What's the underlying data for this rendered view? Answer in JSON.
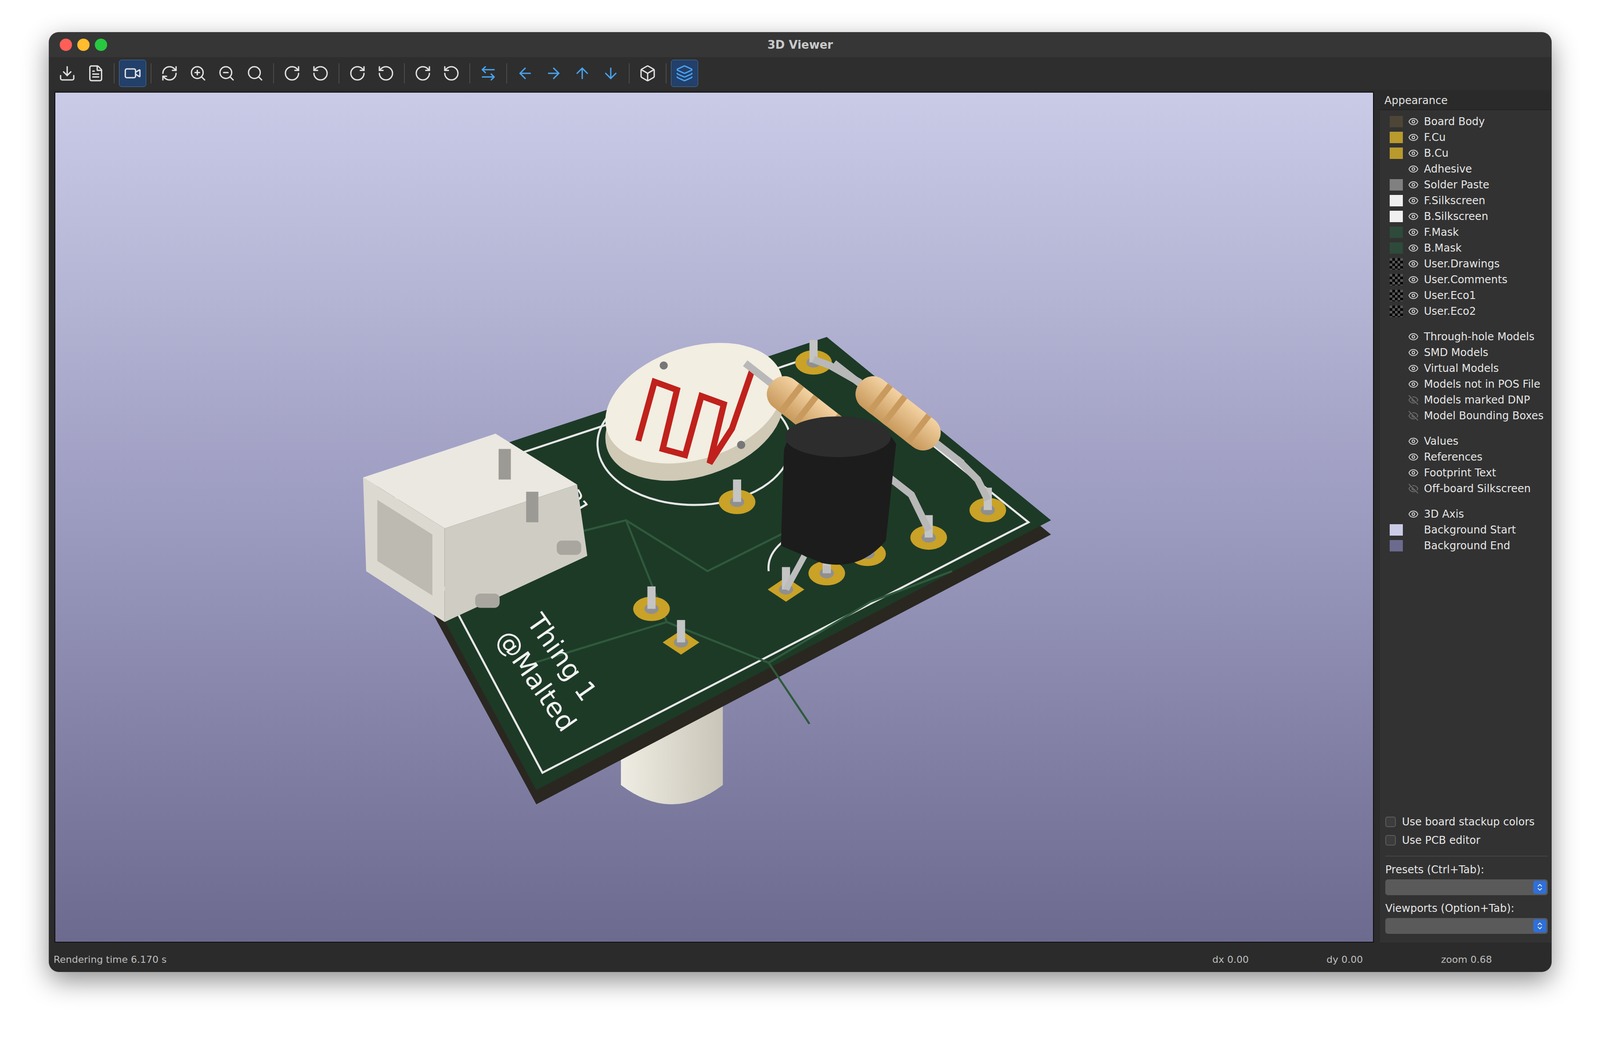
{
  "window": {
    "title": "3D Viewer"
  },
  "toolbar": [
    [
      {
        "selected": false
      },
      {
        "selected": false
      }
    ],
    [
      {
        "selected": true
      }
    ],
    [
      {
        "selected": false
      },
      {
        "selected": false
      },
      {
        "selected": false
      },
      {
        "selected": false
      }
    ],
    [
      {
        "selected": false
      },
      {
        "selected": false
      }
    ],
    [
      {
        "selected": false
      },
      {
        "selected": false
      }
    ],
    [
      {
        "selected": false
      },
      {
        "selected": false
      }
    ],
    [
      {
        "selected": false
      }
    ],
    [
      {
        "selected": false
      },
      {
        "selected": false
      },
      {
        "selected": false
      },
      {
        "selected": false
      }
    ],
    [
      {
        "selected": false
      }
    ],
    [
      {
        "selected": true
      }
    ]
  ],
  "viewport": {
    "silkscreen": {
      "reference": "P1",
      "line1": "Thing 1",
      "line2": "@Malted"
    }
  },
  "appearance": {
    "title": "Appearance",
    "groups": [
      [
        {
          "name": "Board Body",
          "kind": "eye",
          "swatch": "solid",
          "color": "#4d4636",
          "visible": true
        },
        {
          "name": "F.Cu",
          "kind": "eye",
          "swatch": "solid",
          "color": "#b99a2d",
          "visible": true
        },
        {
          "name": "B.Cu",
          "kind": "eye",
          "swatch": "solid",
          "color": "#b99a2d",
          "visible": true
        },
        {
          "name": "Adhesive",
          "kind": "eye",
          "swatch": "none",
          "color": "#303030",
          "visible": true
        },
        {
          "name": "Solder Paste",
          "kind": "eye",
          "swatch": "solid",
          "color": "#808080",
          "visible": true
        },
        {
          "name": "F.Silkscreen",
          "kind": "eye",
          "swatch": "solid",
          "color": "#f0f0f0",
          "visible": true
        },
        {
          "name": "B.Silkscreen",
          "kind": "eye",
          "swatch": "solid",
          "color": "#f0f0f0",
          "visible": true
        },
        {
          "name": "F.Mask",
          "kind": "eye",
          "swatch": "solid",
          "color": "#2d4a3a",
          "visible": true
        },
        {
          "name": "B.Mask",
          "kind": "eye",
          "swatch": "solid",
          "color": "#2d4a3a",
          "visible": true
        },
        {
          "name": "User.Drawings",
          "kind": "eye",
          "swatch": "checker",
          "color": "#000000",
          "visible": true
        },
        {
          "name": "User.Comments",
          "kind": "eye",
          "swatch": "checker",
          "color": "#000000",
          "visible": true
        },
        {
          "name": "User.Eco1",
          "kind": "eye",
          "swatch": "checker",
          "color": "#000000",
          "visible": true
        },
        {
          "name": "User.Eco2",
          "kind": "eye",
          "swatch": "checker",
          "color": "#000000",
          "visible": true
        }
      ],
      [
        {
          "name": "Through-hole Models",
          "kind": "eye",
          "swatch": "none",
          "color": "#303030",
          "visible": true
        },
        {
          "name": "SMD Models",
          "kind": "eye",
          "swatch": "none",
          "color": "#303030",
          "visible": true
        },
        {
          "name": "Virtual Models",
          "kind": "eye",
          "swatch": "none",
          "color": "#303030",
          "visible": true
        },
        {
          "name": "Models not in POS File",
          "kind": "eye",
          "swatch": "none",
          "color": "#303030",
          "visible": true
        },
        {
          "name": "Models marked DNP",
          "kind": "eye",
          "swatch": "none",
          "color": "#303030",
          "visible": false
        },
        {
          "name": "Model Bounding Boxes",
          "kind": "eye",
          "swatch": "none",
          "color": "#303030",
          "visible": false
        }
      ],
      [
        {
          "name": "Values",
          "kind": "eye",
          "swatch": "none",
          "color": "#303030",
          "visible": true
        },
        {
          "name": "References",
          "kind": "eye",
          "swatch": "none",
          "color": "#303030",
          "visible": true
        },
        {
          "name": "Footprint Text",
          "kind": "eye",
          "swatch": "none",
          "color": "#303030",
          "visible": true
        },
        {
          "name": "Off-board Silkscreen",
          "kind": "eye",
          "swatch": "none",
          "color": "#303030",
          "visible": false
        }
      ],
      [
        {
          "name": "3D Axis",
          "kind": "eye",
          "swatch": "none",
          "color": "#303030",
          "visible": true
        },
        {
          "name": "Background Start",
          "kind": "plain",
          "swatch": "solid",
          "color": "#cbcbe8",
          "visible": true
        },
        {
          "name": "Background End",
          "kind": "plain",
          "swatch": "solid",
          "color": "#6c6a8e",
          "visible": true
        }
      ]
    ]
  },
  "options": [
    {
      "label": "Use board stackup colors",
      "checked": false
    },
    {
      "label": "Use PCB editor",
      "checked": false
    }
  ],
  "presets": {
    "label": "Presets (Ctrl+Tab):",
    "value": ""
  },
  "viewports": {
    "label": "Viewports (Option+Tab):",
    "value": ""
  },
  "status_bar": {
    "message": "Rendering time 6.170 s",
    "dx": "dx 0.00",
    "dy": "dy 0.00",
    "zoom": "zoom 0.68"
  }
}
